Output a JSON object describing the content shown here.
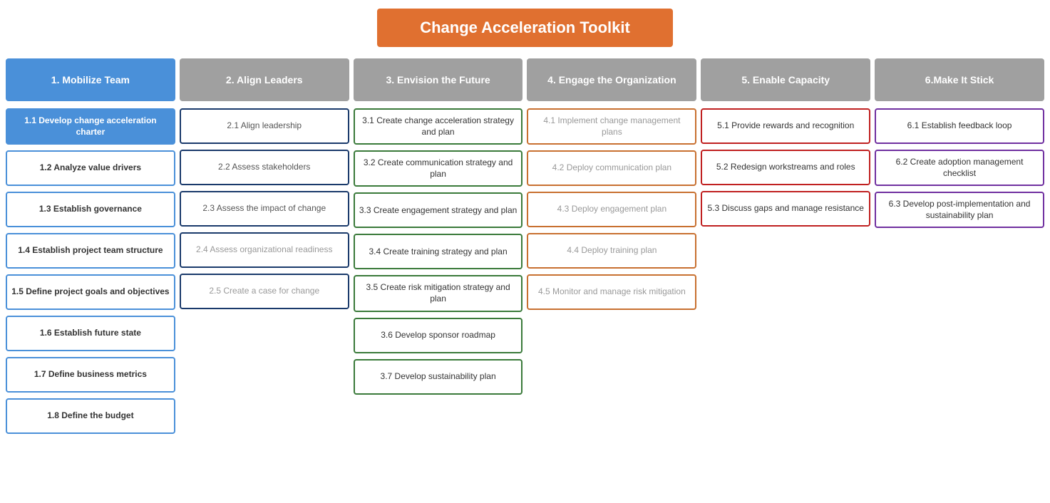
{
  "header": {
    "title": "Change Acceleration Toolkit"
  },
  "columns": [
    {
      "id": "col1",
      "header": "1. Mobilize Team",
      "headerStyle": "blue",
      "cards": [
        {
          "label": "1.1 Develop change acceleration charter",
          "style": "blue-fill"
        },
        {
          "label": "1.2 Analyze value drivers",
          "style": "blue-border"
        },
        {
          "label": "1.3 Establish governance",
          "style": "blue-border"
        },
        {
          "label": "1.4 Establish project team structure",
          "style": "blue-border"
        },
        {
          "label": "1.5 Define project goals and objectives",
          "style": "blue-border"
        },
        {
          "label": "1.6 Establish future state",
          "style": "blue-border"
        },
        {
          "label": "1.7 Define business metrics",
          "style": "blue-border"
        },
        {
          "label": "1.8 Define the budget",
          "style": "blue-border"
        }
      ]
    },
    {
      "id": "col2",
      "header": "2. Align Leaders",
      "headerStyle": "gray",
      "cards": [
        {
          "label": "2.1 Align leadership",
          "style": "dark-blue-border"
        },
        {
          "label": "2.2 Assess stakeholders",
          "style": "dark-blue-border"
        },
        {
          "label": "2.3 Assess the impact of change",
          "style": "dark-blue-border"
        },
        {
          "label": "2.4 Assess organizational readiness",
          "style": "dark-blue-border gray-text"
        },
        {
          "label": "2.5 Create a case for change",
          "style": "dark-blue-border gray-text"
        }
      ]
    },
    {
      "id": "col3",
      "header": "3. Envision the Future",
      "headerStyle": "gray",
      "cards": [
        {
          "label": "3.1 Create change acceleration strategy and plan",
          "style": "green-border"
        },
        {
          "label": "3.2 Create communication strategy and plan",
          "style": "green-border"
        },
        {
          "label": "3.3 Create engagement strategy and plan",
          "style": "green-border"
        },
        {
          "label": "3.4 Create training strategy and plan",
          "style": "green-border"
        },
        {
          "label": "3.5 Create risk mitigation strategy and plan",
          "style": "green-border"
        },
        {
          "label": "3.6 Develop sponsor roadmap",
          "style": "green-border"
        },
        {
          "label": "3.7 Develop sustainability plan",
          "style": "green-border"
        }
      ]
    },
    {
      "id": "col4",
      "header": "4. Engage the Organization",
      "headerStyle": "gray",
      "cards": [
        {
          "label": "4.1 Implement change management plans",
          "style": "orange-border gray-text"
        },
        {
          "label": "4.2 Deploy communication plan",
          "style": "orange-border gray-text"
        },
        {
          "label": "4.3 Deploy engagement plan",
          "style": "orange-border gray-text"
        },
        {
          "label": "4.4 Deploy training plan",
          "style": "orange-border gray-text"
        },
        {
          "label": "4.5 Monitor and manage risk mitigation",
          "style": "orange-border gray-text"
        }
      ]
    },
    {
      "id": "col5",
      "header": "5. Enable Capacity",
      "headerStyle": "gray",
      "cards": [
        {
          "label": "5.1 Provide rewards and recognition",
          "style": "red-border"
        },
        {
          "label": "5.2 Redesign workstreams and roles",
          "style": "red-border"
        },
        {
          "label": "5.3 Discuss gaps and manage resistance",
          "style": "red-border"
        }
      ]
    },
    {
      "id": "col6",
      "header": "6.Make It Stick",
      "headerStyle": "gray",
      "cards": [
        {
          "label": "6.1 Establish feedback loop",
          "style": "purple-border"
        },
        {
          "label": "6.2 Create adoption management checklist",
          "style": "purple-border"
        },
        {
          "label": "6.3 Develop post-implementation and sustainability plan",
          "style": "purple-border"
        }
      ]
    }
  ]
}
